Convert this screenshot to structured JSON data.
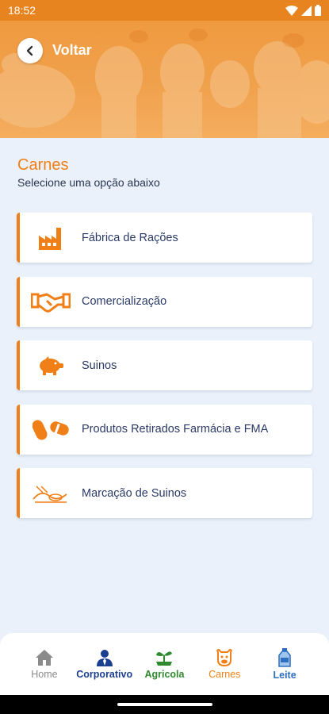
{
  "status_bar": {
    "time": "18:52"
  },
  "header": {
    "back_label": "Voltar"
  },
  "section": {
    "title": "Carnes",
    "subtitle": "Selecione uma opção abaixo"
  },
  "menu": [
    {
      "label": "Fábrica de Rações",
      "icon": "factory-icon"
    },
    {
      "label": "Comercialização",
      "icon": "handshake-icon"
    },
    {
      "label": "Suinos",
      "icon": "pig-icon"
    },
    {
      "label": "Produtos Retirados Farmácia e FMA",
      "icon": "pills-icon"
    },
    {
      "label": "Marcação de Suinos",
      "icon": "pig-marking-icon"
    }
  ],
  "nav": [
    {
      "label": "Home",
      "icon": "home-icon"
    },
    {
      "label": "Corporativo",
      "icon": "person-tie-icon"
    },
    {
      "label": "Agricola",
      "icon": "sprout-icon"
    },
    {
      "label": "Carnes",
      "icon": "bull-icon"
    },
    {
      "label": "Leite",
      "icon": "milk-bottle-icon"
    }
  ],
  "colors": {
    "accent": "#f07f17",
    "background": "#eaf1fb",
    "text": "#2b3a66"
  }
}
